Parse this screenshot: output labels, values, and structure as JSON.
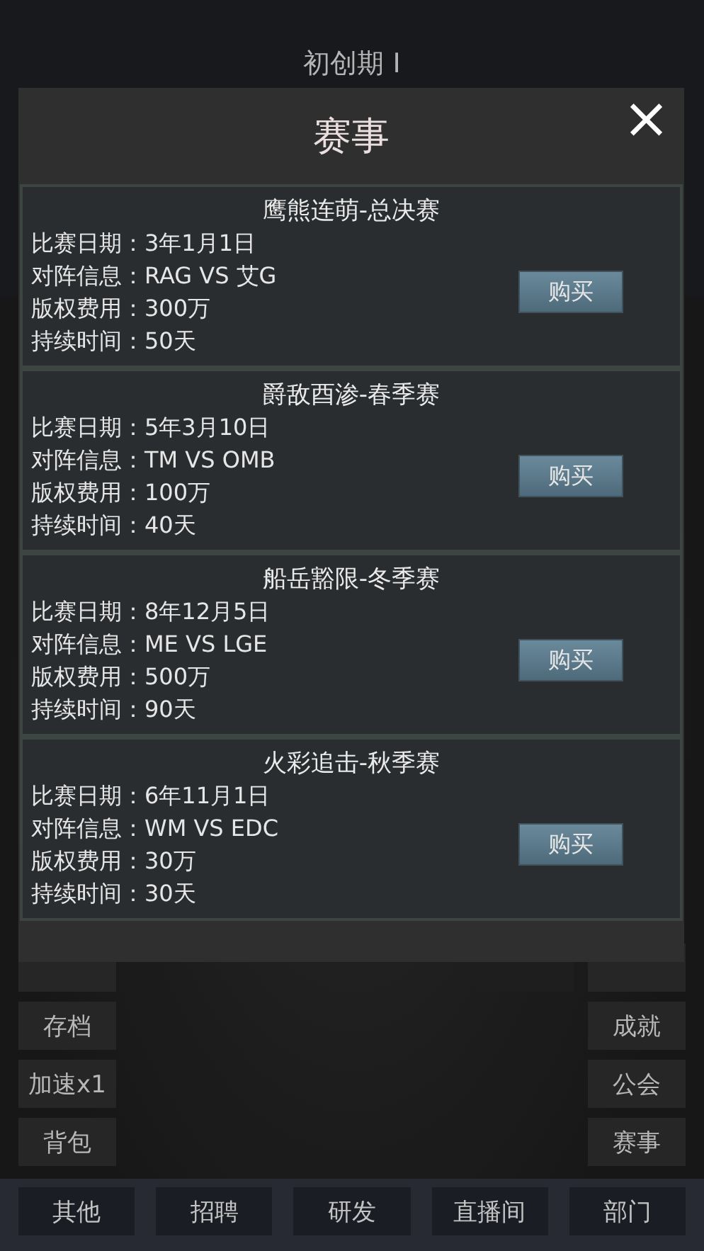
{
  "header": {
    "title": "初创期 I"
  },
  "side_left": [
    "存档",
    "加速x1",
    "背包"
  ],
  "side_right": [
    "成就",
    "公会",
    "赛事"
  ],
  "bottom_nav": [
    "其他",
    "招聘",
    "研发",
    "直播间",
    "部门"
  ],
  "dialog": {
    "title": "赛事",
    "close": "×",
    "events": [
      {
        "name": "鹰熊连萌-总决赛",
        "fields": [
          {
            "label": "比赛日期：",
            "value": "3年1月1日"
          },
          {
            "label": "对阵信息：",
            "value": "RAG VS 艾G"
          },
          {
            "label": "版权费用：",
            "value": "300万"
          },
          {
            "label": "持续时间：",
            "value": "50天"
          }
        ],
        "button": "购买"
      },
      {
        "name": "爵敌酉渗-春季赛",
        "fields": [
          {
            "label": "比赛日期：",
            "value": "5年3月10日"
          },
          {
            "label": "对阵信息：",
            "value": "TM VS OMB"
          },
          {
            "label": "版权费用：",
            "value": "100万"
          },
          {
            "label": "持续时间：",
            "value": "40天"
          }
        ],
        "button": "购买"
      },
      {
        "name": "船岳豁限-冬季赛",
        "fields": [
          {
            "label": "比赛日期：",
            "value": "8年12月5日"
          },
          {
            "label": "对阵信息：",
            "value": "ME VS LGE"
          },
          {
            "label": "版权费用：",
            "value": "500万"
          },
          {
            "label": "持续时间：",
            "value": "90天"
          }
        ],
        "button": "购买"
      },
      {
        "name": "火彩追击-秋季赛",
        "fields": [
          {
            "label": "比赛日期：",
            "value": "6年11月1日"
          },
          {
            "label": "对阵信息：",
            "value": "WM VS EDC"
          },
          {
            "label": "版权费用：",
            "value": "30万"
          },
          {
            "label": "持续时间：",
            "value": "30天"
          }
        ],
        "button": "购买"
      }
    ]
  }
}
